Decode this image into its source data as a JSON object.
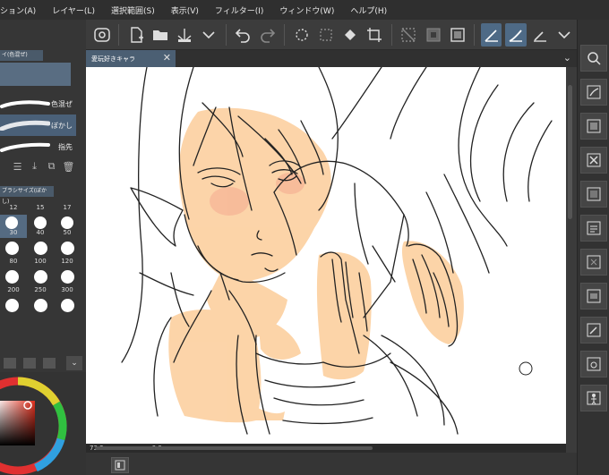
{
  "menubar": {
    "items": [
      "ション(A)",
      "レイヤー(L)",
      "選択範囲(S)",
      "表示(V)",
      "フィルター(I)",
      "ウィンドウ(W)",
      "ヘルプ(H)"
    ]
  },
  "toolbar": {
    "icons": [
      "app-logo-icon",
      "new-file-icon",
      "open-folder-icon",
      "save-icon",
      "chevron-down-icon",
      "undo-icon",
      "redo-icon",
      "sparkle-icon",
      "transform-icon",
      "fill-icon",
      "crop-icon",
      "deselect-icon",
      "invert-selection-icon",
      "selection-border-icon",
      "pen-tool-icon",
      "brush-tool-icon",
      "pencil-tool-icon",
      "chevron-down-icon"
    ],
    "active_indices": [
      14,
      15
    ]
  },
  "document_tab": {
    "title": "愛玩好きキャラ",
    "close": "✕"
  },
  "left_panel": {
    "tab_label": "イ(色混ぜ)",
    "brushes": [
      {
        "label": "色混ぜ",
        "selected": false
      },
      {
        "label": "ぼかし",
        "selected": true
      },
      {
        "label": "指先",
        "selected": false
      }
    ],
    "size_tab_label": "ブラシサイズ(ぼかし)",
    "size_columns": [
      "12",
      "15",
      "17"
    ],
    "sizes": [
      "30",
      "40",
      "50",
      "80",
      "100",
      "120",
      "200",
      "250",
      "300"
    ],
    "selected_size": "30"
  },
  "status_bar": {
    "zoom": "73.3",
    "angle": "0.0"
  },
  "colors": {
    "accent": "#4e6a86",
    "skin": "#fcd2a4",
    "canvas": "#ffffff"
  }
}
